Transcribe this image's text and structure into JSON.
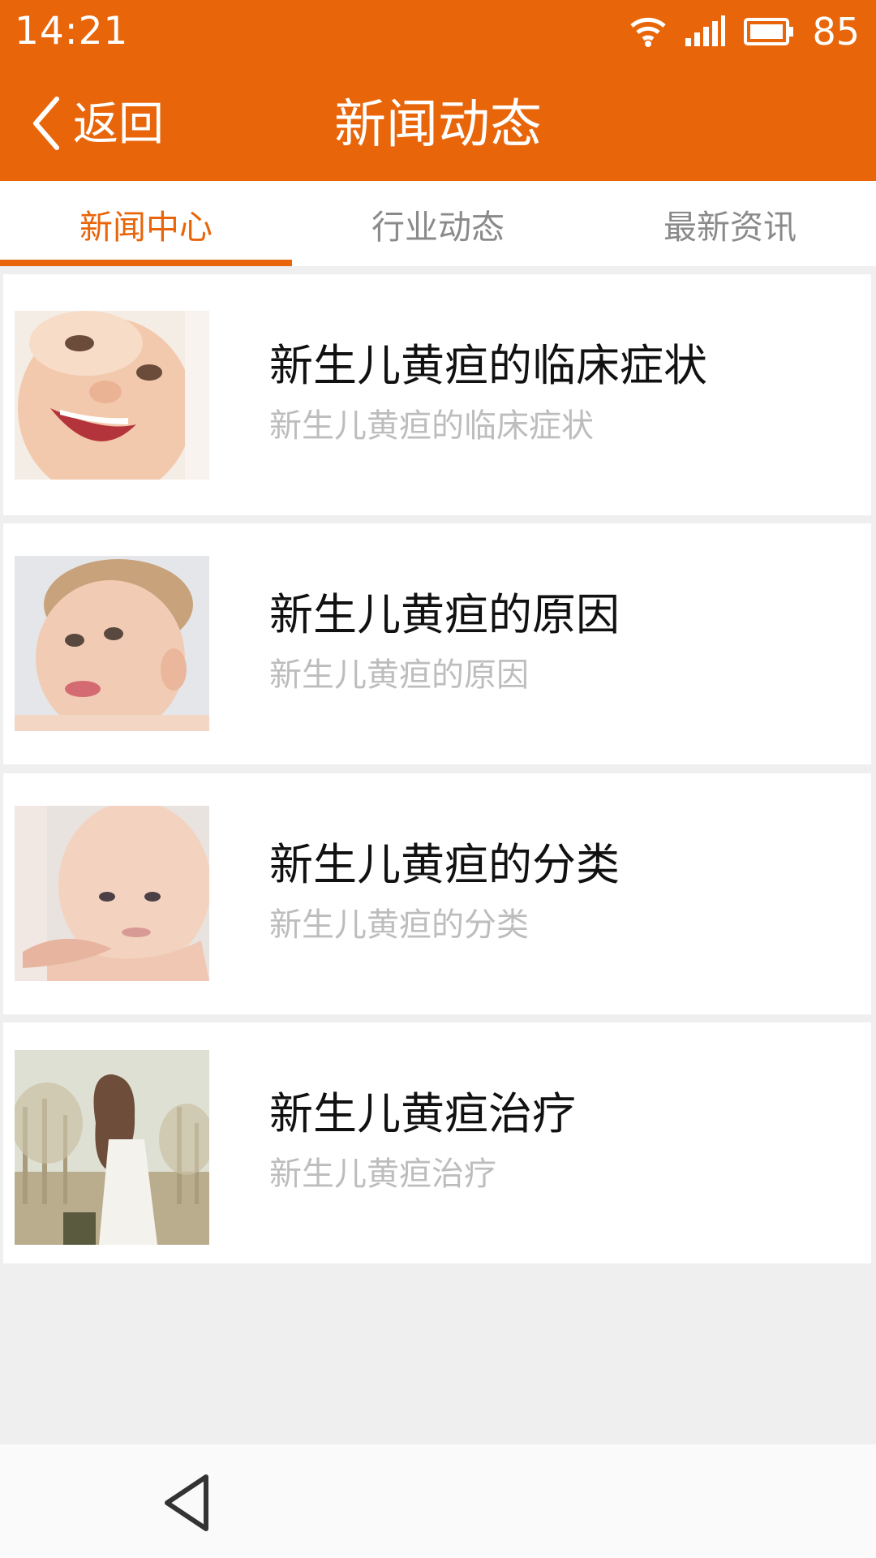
{
  "status_bar": {
    "time": "14:21",
    "battery_level": "85",
    "icons": [
      "wifi-icon",
      "signal-icon",
      "battery-icon"
    ]
  },
  "header": {
    "back_label": "返回",
    "title": "新闻动态",
    "background_color": "#e8650a"
  },
  "tabs": [
    {
      "label": "新闻中心",
      "active": true
    },
    {
      "label": "行业动态",
      "active": false
    },
    {
      "label": "最新资讯",
      "active": false
    }
  ],
  "news": [
    {
      "title": "新生儿黄疸的临床症状",
      "summary": "新生儿黄疸的临床症状",
      "thumbnail": "laughing-baby-photo"
    },
    {
      "title": "新生儿黄疸的原因",
      "summary": "新生儿黄疸的原因",
      "thumbnail": "baby-tongue-out-photo"
    },
    {
      "title": "新生儿黄疸的分类",
      "summary": "新生儿黄疸的分类",
      "thumbnail": "baby-held-face-photo"
    },
    {
      "title": "新生儿黄疸治疗",
      "summary": "新生儿黄疸治疗",
      "thumbnail": "girl-in-white-dress-photo"
    }
  ],
  "system_nav": {
    "icons": [
      "back-triangle-icon"
    ]
  },
  "colors": {
    "accent": "#e8650a",
    "title_text": "#111111",
    "summary_text": "#bdbdbd",
    "inactive_tab": "#8a8a8a",
    "list_background": "#efefef"
  }
}
